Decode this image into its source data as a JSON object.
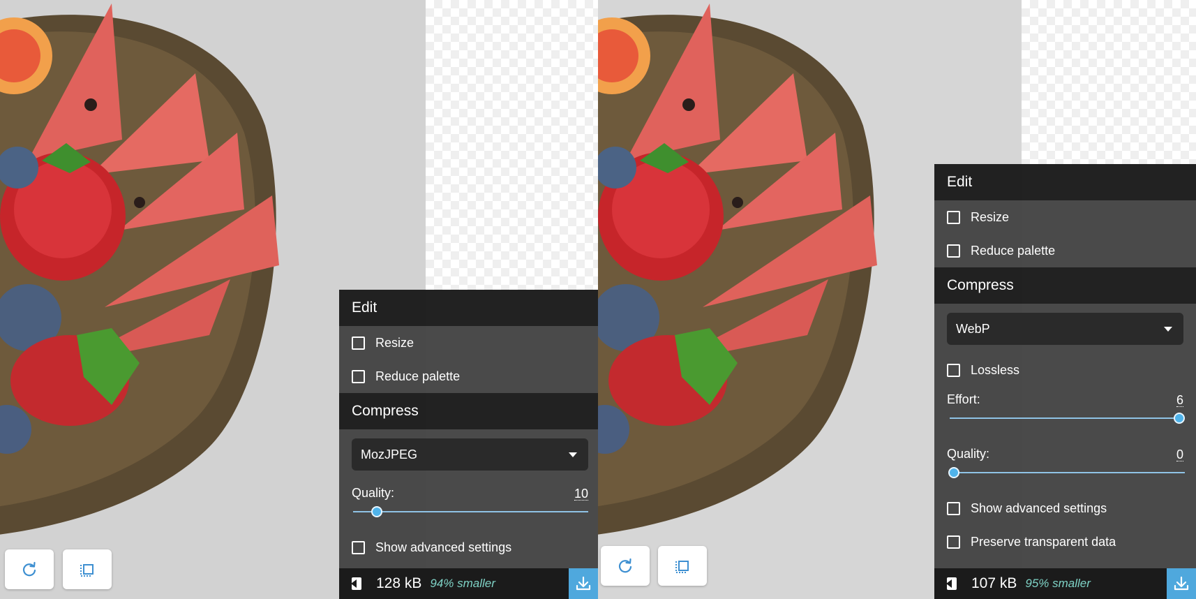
{
  "left": {
    "edit_title": "Edit",
    "resize_label": "Resize",
    "reduce_palette_label": "Reduce palette",
    "compress_title": "Compress",
    "encoder": "MozJPEG",
    "quality_label": "Quality:",
    "quality_value": "10",
    "quality_fraction": 0.1,
    "advanced_label": "Show advanced settings",
    "size": "128 kB",
    "saving": "94% smaller"
  },
  "right": {
    "edit_title": "Edit",
    "resize_label": "Resize",
    "reduce_palette_label": "Reduce palette",
    "compress_title": "Compress",
    "encoder": "WebP",
    "lossless_label": "Lossless",
    "effort_label": "Effort:",
    "effort_value": "6",
    "effort_fraction": 1.0,
    "quality_label": "Quality:",
    "quality_value": "0",
    "quality_fraction": 0.0,
    "advanced_label": "Show advanced settings",
    "preserve_label": "Preserve transparent data",
    "size": "107 kB",
    "saving": "95% smaller"
  },
  "icons": {
    "rotate": "rotate-icon",
    "crop": "crop-icon",
    "back": "back-arrow-icon",
    "download": "download-icon"
  },
  "colors": {
    "accent": "#4fa8dd",
    "saving_text": "#7fd3c6"
  }
}
